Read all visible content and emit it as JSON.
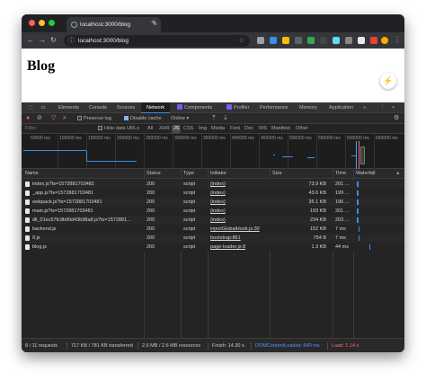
{
  "browser": {
    "tab_title": "localhost:3000/blog",
    "close_tab_glyph": "×",
    "new_tab_glyph": "+",
    "url": "localhost:3000/blog"
  },
  "page": {
    "heading": "Blog",
    "bolt_glyph": "⚡"
  },
  "devtools": {
    "tabs": [
      "Elements",
      "Console",
      "Sources",
      "Network",
      "Components",
      "Profiler",
      "Performance",
      "Memory",
      "Application"
    ],
    "more_glyph": "»",
    "close_glyph": "×",
    "active_tab": "Network",
    "toolbar": {
      "preserve_log": "Preserve log",
      "disable_cache": "Disable cache",
      "throttle": "Online"
    },
    "filter": {
      "placeholder": "Filter",
      "hide_data_urls": "Hide data URLs",
      "types": [
        "All",
        "XHR",
        "JS",
        "CSS",
        "Img",
        "Media",
        "Font",
        "Doc",
        "WS",
        "Manifest",
        "Other"
      ],
      "selected": "JS"
    },
    "timeline_ticks": [
      "50000 ms",
      "100000 ms",
      "150000 ms",
      "200000 ms",
      "250000 ms",
      "300000 ms",
      "350000 ms",
      "400000 ms",
      "450000 ms",
      "500000 ms",
      "550000 ms",
      "600000 ms",
      "650000 ms"
    ],
    "columns": [
      "Name",
      "Status",
      "Type",
      "Initiator",
      "Size",
      "Time",
      "Waterfall"
    ],
    "sort_glyph": "▲",
    "rows": [
      {
        "name": "index.js?ts=1572881703481",
        "status": "200",
        "type": "script",
        "initiator": "(index)",
        "size": "73.9 KB",
        "time": "201 ..."
      },
      {
        "name": "_app.js?ts=1572881703481",
        "status": "200",
        "type": "script",
        "initiator": "(index)",
        "size": "43.6 KB",
        "time": "199 ..."
      },
      {
        "name": "webpack.js?ts=1572881703481",
        "status": "200",
        "type": "script",
        "initiator": "(index)",
        "size": "35.1 KB",
        "time": "196 ..."
      },
      {
        "name": "main.js?ts=1572881703481",
        "status": "200",
        "type": "script",
        "initiator": "(index)",
        "size": "193 KB",
        "time": "201 ..."
      },
      {
        "name": "dll_01ec57fc9b90d43b98a8.js?ts=1572881...",
        "status": "200",
        "type": "script",
        "initiator": "(index)",
        "size": "234 KB",
        "time": "203 ..."
      },
      {
        "name": "backend.js",
        "status": "200",
        "type": "script",
        "initiator": "injectGlobalHook.js:30",
        "size": "152 KB",
        "time": "7 ms"
      },
      {
        "name": "0.js",
        "status": "200",
        "type": "script",
        "initiator": "bootstrap:861",
        "size": "754 B",
        "time": "7 ms"
      },
      {
        "name": "blog.js",
        "status": "200",
        "type": "script",
        "initiator": "page-loader.js:8",
        "size": "1.3 KB",
        "time": "44 ms"
      }
    ],
    "summary": {
      "requests": "8 / 11 requests",
      "transferred": "717 KB / 781 KB transferred",
      "resources": "2.6 MB / 2.6 MB resources",
      "finish": "Finish: 14.30 s",
      "dcl": "DOMContentLoaded: 640 ms",
      "load": "Load: 1.14 s"
    },
    "colors": {
      "dcl": "#4c9aff",
      "load": "#ff6b6b",
      "accent": "#3c8ee6"
    }
  }
}
